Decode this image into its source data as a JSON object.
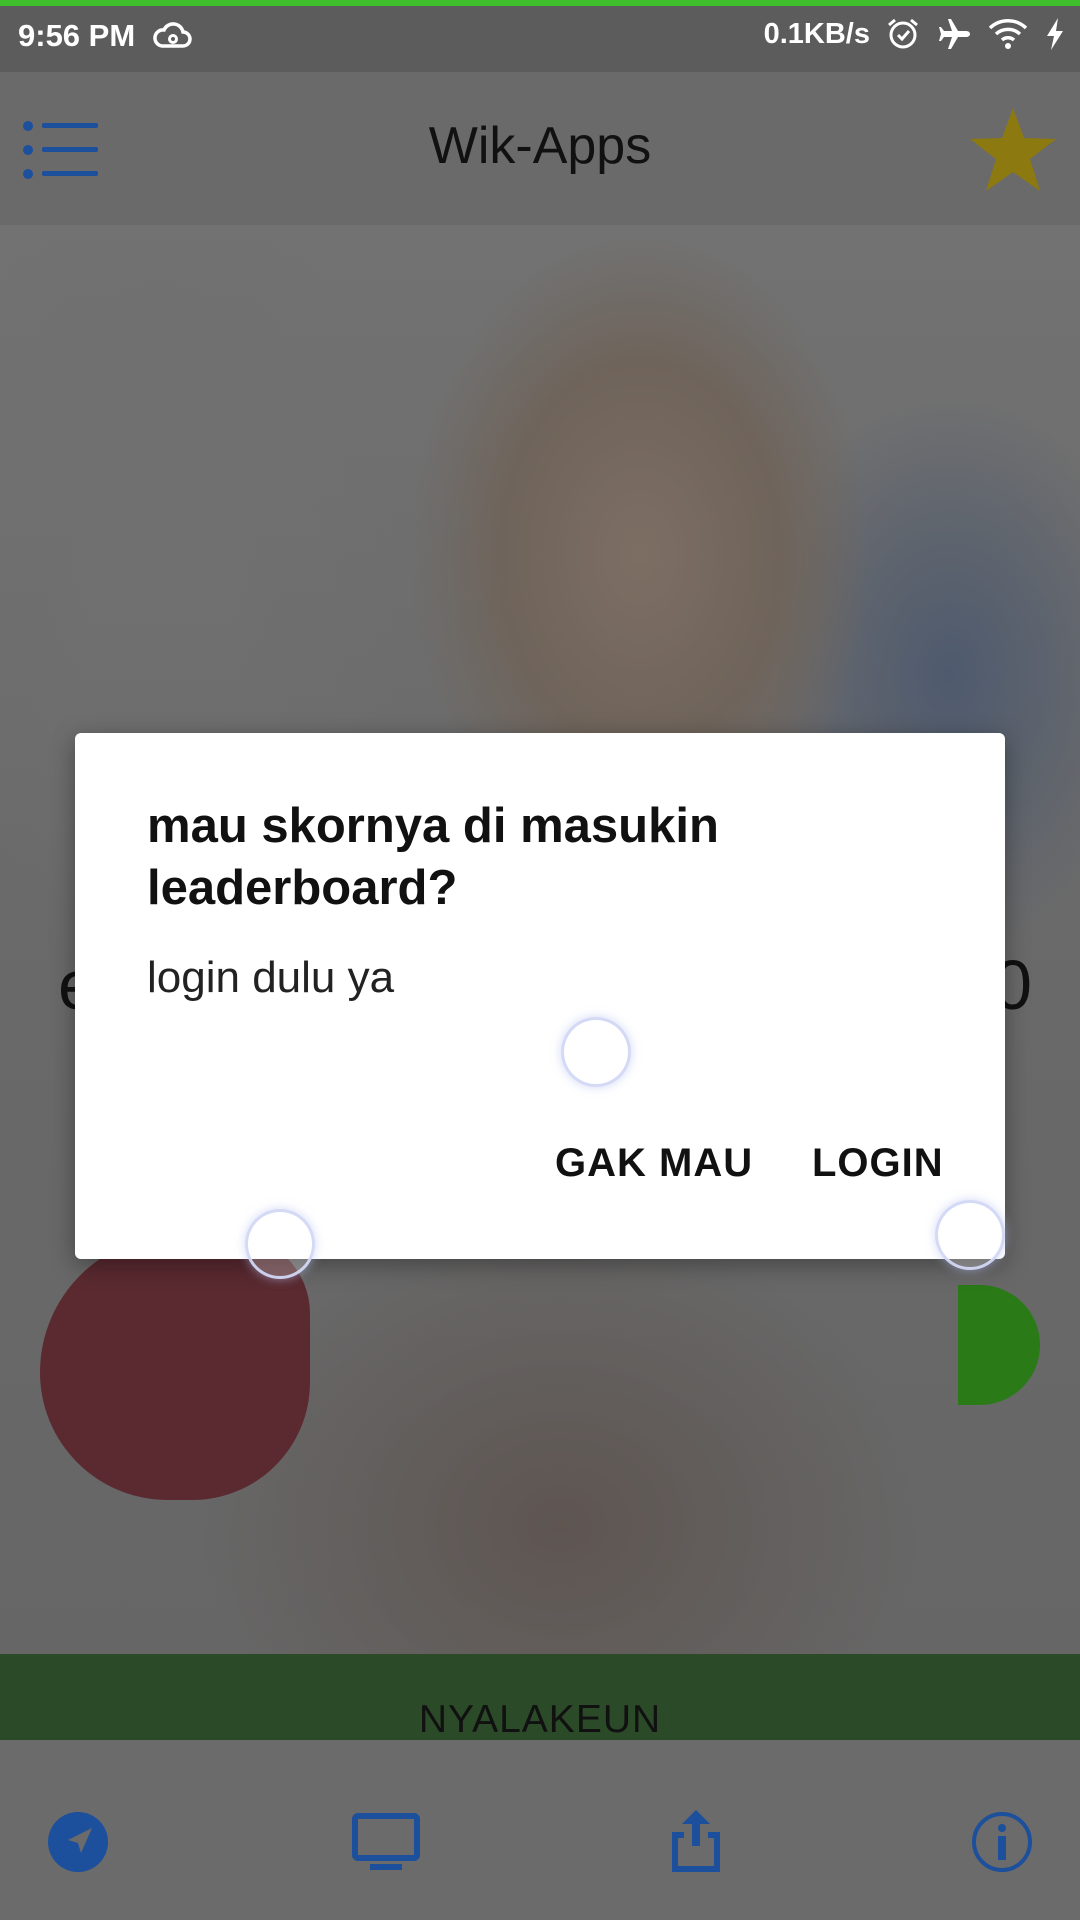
{
  "status_bar": {
    "time": "9:56 PM",
    "network_speed": "0.1KB/s",
    "icons": [
      "cloud-icon",
      "alarm-icon",
      "airplane-icon",
      "wifi-icon",
      "charging-icon"
    ]
  },
  "app_bar": {
    "title": "Wik-Apps",
    "menu_icon": "menu-list-icon",
    "favorite_icon": "star-icon",
    "star_color": "#8c7a10"
  },
  "screen": {
    "score_left": "e",
    "score_right": "0",
    "action_button_label": "NYALAKEUN"
  },
  "dialog": {
    "title": "mau skornya di masukin leaderboard?",
    "message": "login dulu ya",
    "negative_button": "GAK MAU",
    "positive_button": "LOGIN"
  },
  "bottom_nav": {
    "items": [
      {
        "icon": "navigate-icon"
      },
      {
        "icon": "monitor-icon"
      },
      {
        "icon": "share-icon"
      },
      {
        "icon": "info-icon"
      }
    ],
    "icon_color": "#1c4f9c"
  }
}
